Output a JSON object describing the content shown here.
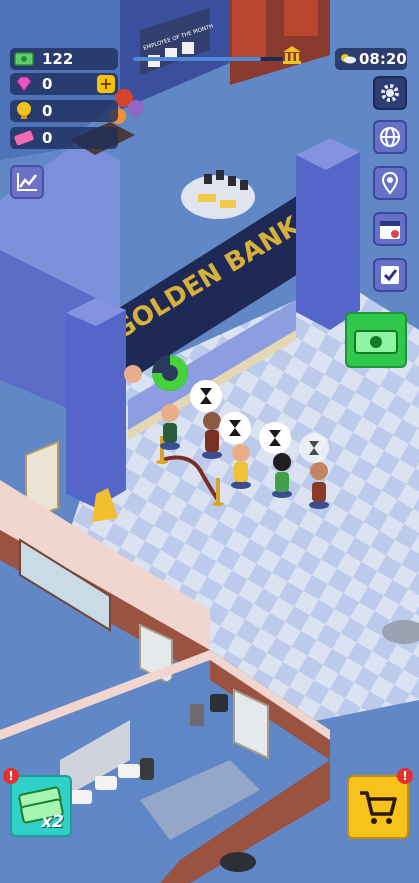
{
  "resources": {
    "cash": "122",
    "gems": "0",
    "ideas": "0",
    "tickets": "0",
    "gems_add_label": "+"
  },
  "hud": {
    "time": "08:20",
    "level_progress": 0.85
  },
  "scene": {
    "bank_sign": "GOLDEN BANK",
    "employee_board": "EMPLOYEE OF THE MONTH"
  },
  "boost": {
    "label": "x2",
    "alert": "!"
  },
  "shop": {
    "alert": "!"
  },
  "colors": {
    "floor_light": "#dbe3f2",
    "floor_dark": "#bccaeb",
    "wall_blue": "#5c70c9",
    "brick": "#9a5340",
    "cash_green": "#2fc84a",
    "shop_yellow": "#f6c21b"
  }
}
